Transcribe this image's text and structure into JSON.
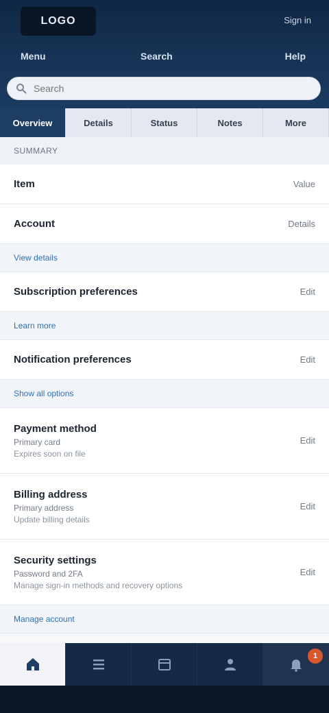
{
  "header": {
    "logo_text": "LOGO",
    "top_link": "Sign in",
    "nav_left": "Menu",
    "nav_center": "Search",
    "nav_right": "Help"
  },
  "search": {
    "placeholder": "Search",
    "value": ""
  },
  "tabs": [
    {
      "label": "Overview"
    },
    {
      "label": "Details"
    },
    {
      "label": "Status"
    },
    {
      "label": "Notes"
    },
    {
      "label": "More"
    }
  ],
  "section": {
    "title": "Summary"
  },
  "rows": [
    {
      "title": "Item",
      "value": "Value"
    },
    {
      "title": "Account",
      "value": "Details"
    }
  ],
  "link1": "View details",
  "rows2": [
    {
      "title": "Subscription preferences",
      "value": "Edit"
    }
  ],
  "link2": "Learn more",
  "rows3": [
    {
      "title": "Notification preferences",
      "value": "Edit"
    }
  ],
  "link3": "Show all options",
  "rows4": [
    {
      "title": "Payment method",
      "sub": "Primary card",
      "sub2": "Expires soon on file",
      "value": "Edit"
    },
    {
      "title": "Billing address",
      "sub": "Primary address",
      "sub2": "Update billing details",
      "value": "Edit"
    },
    {
      "title": "Security settings",
      "sub": "Password and 2FA",
      "sub2": "Manage sign-in methods and recovery options",
      "value": "Edit"
    }
  ],
  "link4": "Manage account",
  "bottom_nav": {
    "badge": "1"
  }
}
